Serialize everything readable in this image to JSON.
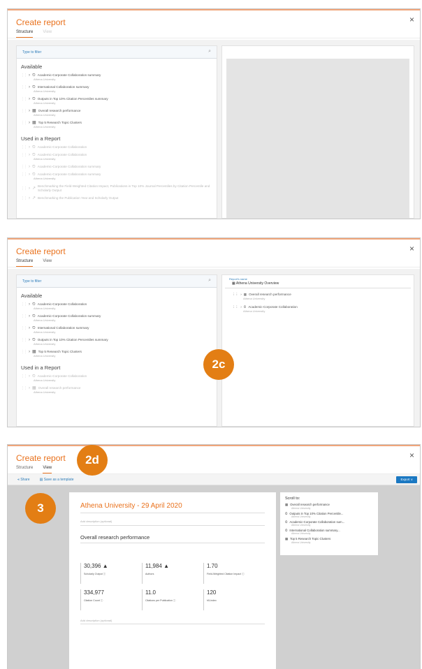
{
  "panel1": {
    "title": "Create report",
    "close_label": "×",
    "tabs": [
      "Structure",
      "View"
    ],
    "filter_placeholder": "Type to filter",
    "available_heading": "Available",
    "available": [
      {
        "icon": "clock",
        "label": "Academic-Corporate Collaboration summary",
        "sub": "Athena University"
      },
      {
        "icon": "clock",
        "label": "International Collaboration summary",
        "sub": "Athena University"
      },
      {
        "icon": "clock",
        "label": "Outputs in Top 10% Citation Percentiles summary",
        "sub": "Athena University"
      },
      {
        "icon": "grid",
        "label": "Overall research performance",
        "sub": "Athena University"
      },
      {
        "icon": "grid",
        "label": "Top 5 Research Topic Clusters",
        "sub": "Athena University"
      }
    ],
    "used_heading": "Used in a Report",
    "used": [
      {
        "icon": "clock",
        "label": "Academic-Corporate Collaboration"
      },
      {
        "icon": "clock",
        "label": "Academic-Corporate Collaboration",
        "sub": "Athena University"
      },
      {
        "icon": "clock",
        "label": "Academic-Corporate Collaboration summary"
      },
      {
        "icon": "clock",
        "label": "Academic-Corporate Collaboration summary",
        "sub": "Athena University"
      },
      {
        "icon": "chart",
        "label": "Benchmarking the Field-Weighted Citation Impact, Publications in Top 10% Journal Percentiles by Citation Percentile and Scholarly Output"
      },
      {
        "icon": "chart",
        "label": "Benchmarking the Publication Year and Scholarly Output"
      }
    ]
  },
  "panel2": {
    "title": "Create report",
    "close_label": "×",
    "tabs": [
      "Structure",
      "View"
    ],
    "filter_placeholder": "Type to filter",
    "available_heading": "Available",
    "available": [
      {
        "icon": "clock",
        "label": "Academic-Corporate Collaboration",
        "sub": "Athena University"
      },
      {
        "icon": "clock",
        "label": "Academic-Corporate Collaboration summary",
        "sub": "Athena University"
      },
      {
        "icon": "clock",
        "label": "International Collaboration summary",
        "sub": "Athena University"
      },
      {
        "icon": "clock",
        "label": "Outputs in Top 10% Citation Percentiles summary",
        "sub": "Athena University"
      },
      {
        "icon": "grid",
        "label": "Top 5 Research Topic Clusters",
        "sub": "Athena University"
      }
    ],
    "used_heading": "Used in a Report",
    "used": [
      {
        "icon": "clock",
        "label": "Academic-Corporate Collaboration",
        "sub": "Athena University"
      },
      {
        "icon": "grid",
        "label": "Overall research performance",
        "sub": "Athena University"
      }
    ],
    "report_name_label": "Report's name",
    "report_name": "Athena University Overview",
    "report_items": [
      {
        "icon": "grid",
        "label": "Overall research performance",
        "sub": "Athena University"
      },
      {
        "icon": "clock",
        "label": "Academic-Corporate Collaboration",
        "sub": "Athena University"
      }
    ]
  },
  "panel3": {
    "title": "Create report",
    "close_label": "×",
    "tabs": [
      "Structure",
      "View"
    ],
    "toolbar": {
      "share": "Share",
      "template": "Save as a template",
      "export": "Export ∨"
    },
    "report_title": "Athena University - 29 April 2020",
    "add_description": "Add description (optional)",
    "section_title": "Overall research performance",
    "metrics": [
      {
        "value": "30,396 ▲",
        "label": "Scholarly Output ⓘ"
      },
      {
        "value": "11,984 ▲",
        "label": "Authors"
      },
      {
        "value": "1.70",
        "label": "Field-Weighted Citation Impact ⓘ"
      },
      {
        "value": "334,977",
        "label": "Citation Count ⓘ"
      },
      {
        "value": "11.0",
        "label": "Citations per Publication ⓘ"
      },
      {
        "value": "120",
        "label": "h5-index"
      }
    ],
    "add_description_2": "Add description (optional)",
    "scroll_to": {
      "title": "Scroll to:",
      "items": [
        {
          "icon": "grid",
          "label": "Overall research performance",
          "sub": "Athena University"
        },
        {
          "icon": "clock",
          "label": "Outputs in Top 10% Citation Percentile...",
          "sub": "Athena University"
        },
        {
          "icon": "clock",
          "label": "Academic-Corporate Collaboration sum...",
          "sub": "Athena University"
        },
        {
          "icon": "clock",
          "label": "International Collaboration summary...",
          "sub": "Athena University"
        },
        {
          "icon": "grid",
          "label": "Top 5 Research Topic Clusters",
          "sub": "Athena University"
        }
      ]
    }
  },
  "badges": {
    "b2c": "2c",
    "b2d": "2d",
    "b3": "3"
  },
  "colors": {
    "accent": "#e9711c",
    "badge": "#e37e14",
    "link": "#2e7db9",
    "export_button": "#1a78c2"
  }
}
